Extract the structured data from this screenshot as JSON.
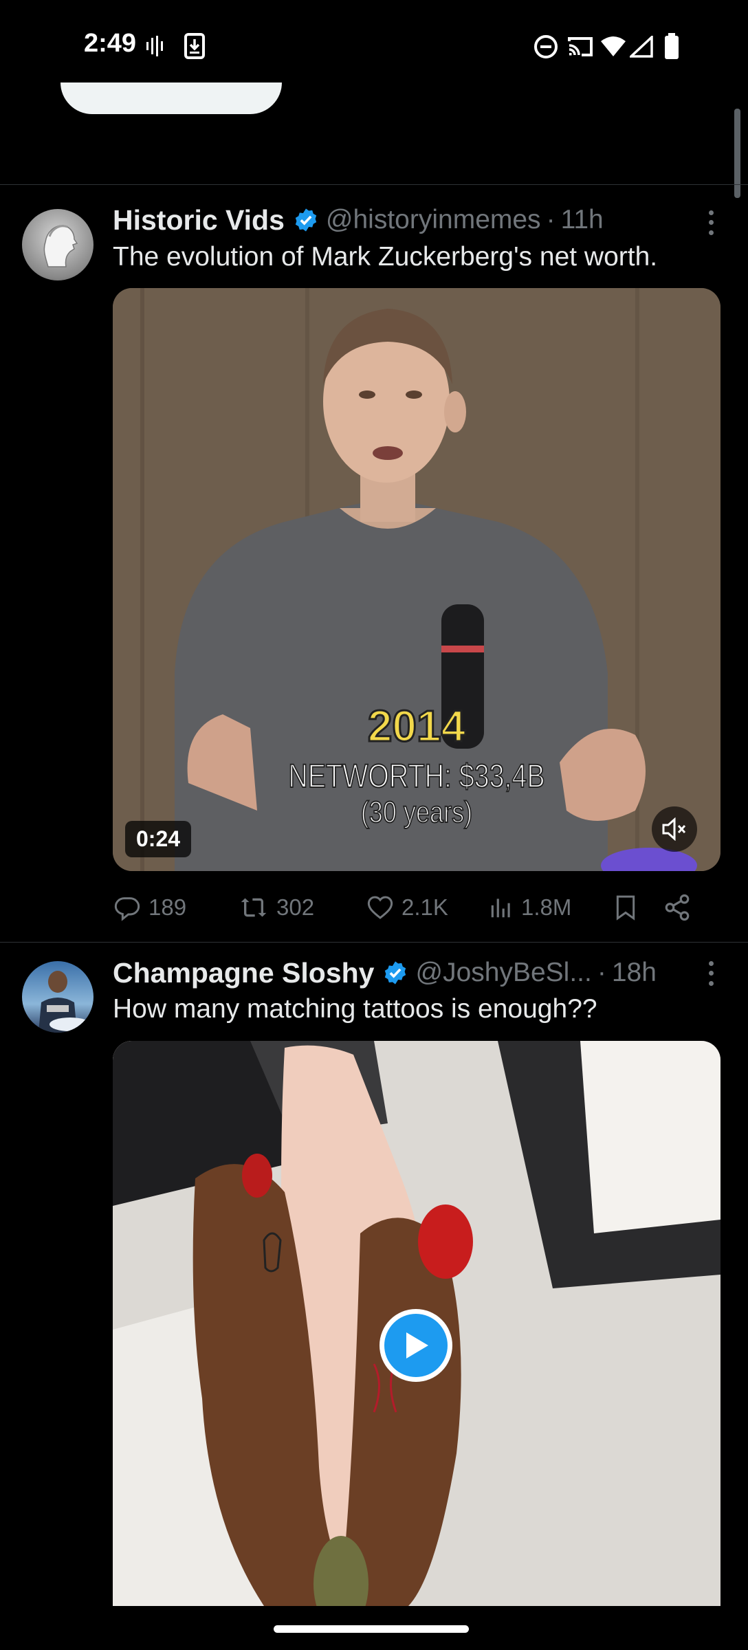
{
  "status_bar": {
    "time": "2:49",
    "left_icons": [
      "audio-wave-icon",
      "download-notification-icon"
    ],
    "right_icons": [
      "do-not-disturb-icon",
      "cast-icon",
      "wifi-icon",
      "signal-icon",
      "battery-icon"
    ]
  },
  "tweets": [
    {
      "display_name": "Historic Vids",
      "verified": true,
      "handle": "@historyinmemes",
      "separator": "·",
      "time": "11h",
      "text": "The evolution of Mark Zuckerberg's net worth.",
      "media": {
        "type": "video",
        "duration": "0:24",
        "caption_year": "2014",
        "caption_networth": "NETWORTH: $33,4B",
        "caption_age": "(30 years)",
        "muted": true
      },
      "stats": {
        "replies": "189",
        "reposts": "302",
        "likes": "2.1K",
        "views": "1.8M"
      }
    },
    {
      "display_name": "Champagne Sloshy",
      "verified": true,
      "handle": "@JoshyBeSl...",
      "separator": "·",
      "time": "18h",
      "text": "How many matching tattoos is enough??",
      "media": {
        "type": "video",
        "playing": false
      }
    }
  ],
  "colors": {
    "background": "#000000",
    "verified_blue": "#1d9bf0",
    "secondary_text": "#71767b",
    "primary_text": "#e7e9ea"
  }
}
